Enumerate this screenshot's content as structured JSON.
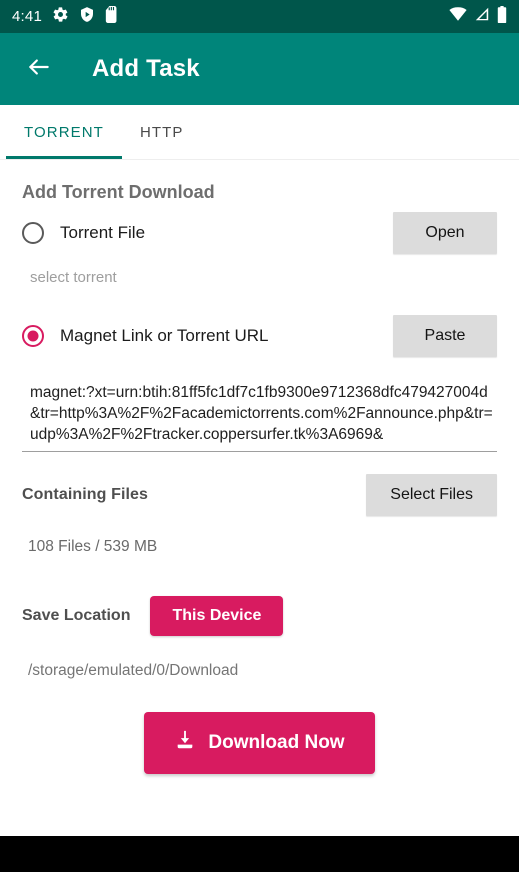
{
  "statusbar": {
    "time": "4:41",
    "left_icons": [
      "gear-icon",
      "shield-play-icon",
      "sd-card-icon"
    ],
    "right_icons": [
      "wifi-icon",
      "cellular-signal-icon",
      "battery-icon"
    ],
    "background_color": "#00564B"
  },
  "appbar": {
    "back_icon": "arrow-left-icon",
    "title": "Add Task",
    "background_color": "#00857A"
  },
  "tabs": [
    {
      "label": "TORRENT",
      "active": true
    },
    {
      "label": "HTTP",
      "active": false
    }
  ],
  "form": {
    "section_title": "Add Torrent Download",
    "torrent_file": {
      "radio_label": "Torrent File",
      "selected": false,
      "button_label": "Open",
      "hint": "select torrent"
    },
    "magnet": {
      "radio_label": "Magnet Link or Torrent URL",
      "selected": true,
      "button_label": "Paste",
      "value": "magnet:?xt=urn:btih:81ff5fc1df7c1fb9300e9712368dfc479427004d&tr=http%3A%2F%2Facademictorrents.com%2Fannounce.php&tr=udp%3A%2F%2Ftracker.coppersurfer.tk%3A6969&"
    },
    "containing_files": {
      "label": "Containing Files",
      "button_label": "Select Files",
      "info": "108 Files / 539 MB"
    },
    "save_location": {
      "label": "Save Location",
      "button_label": "This Device",
      "path": "/storage/emulated/0/Download"
    },
    "submit": {
      "label": "Download Now",
      "icon": "download-icon"
    }
  },
  "colors": {
    "accent_pink": "#D81B60",
    "primary_teal": "#00857A",
    "status_teal": "#00564B",
    "tab_active": "#00796B",
    "button_gray": "#DCDCDC"
  }
}
